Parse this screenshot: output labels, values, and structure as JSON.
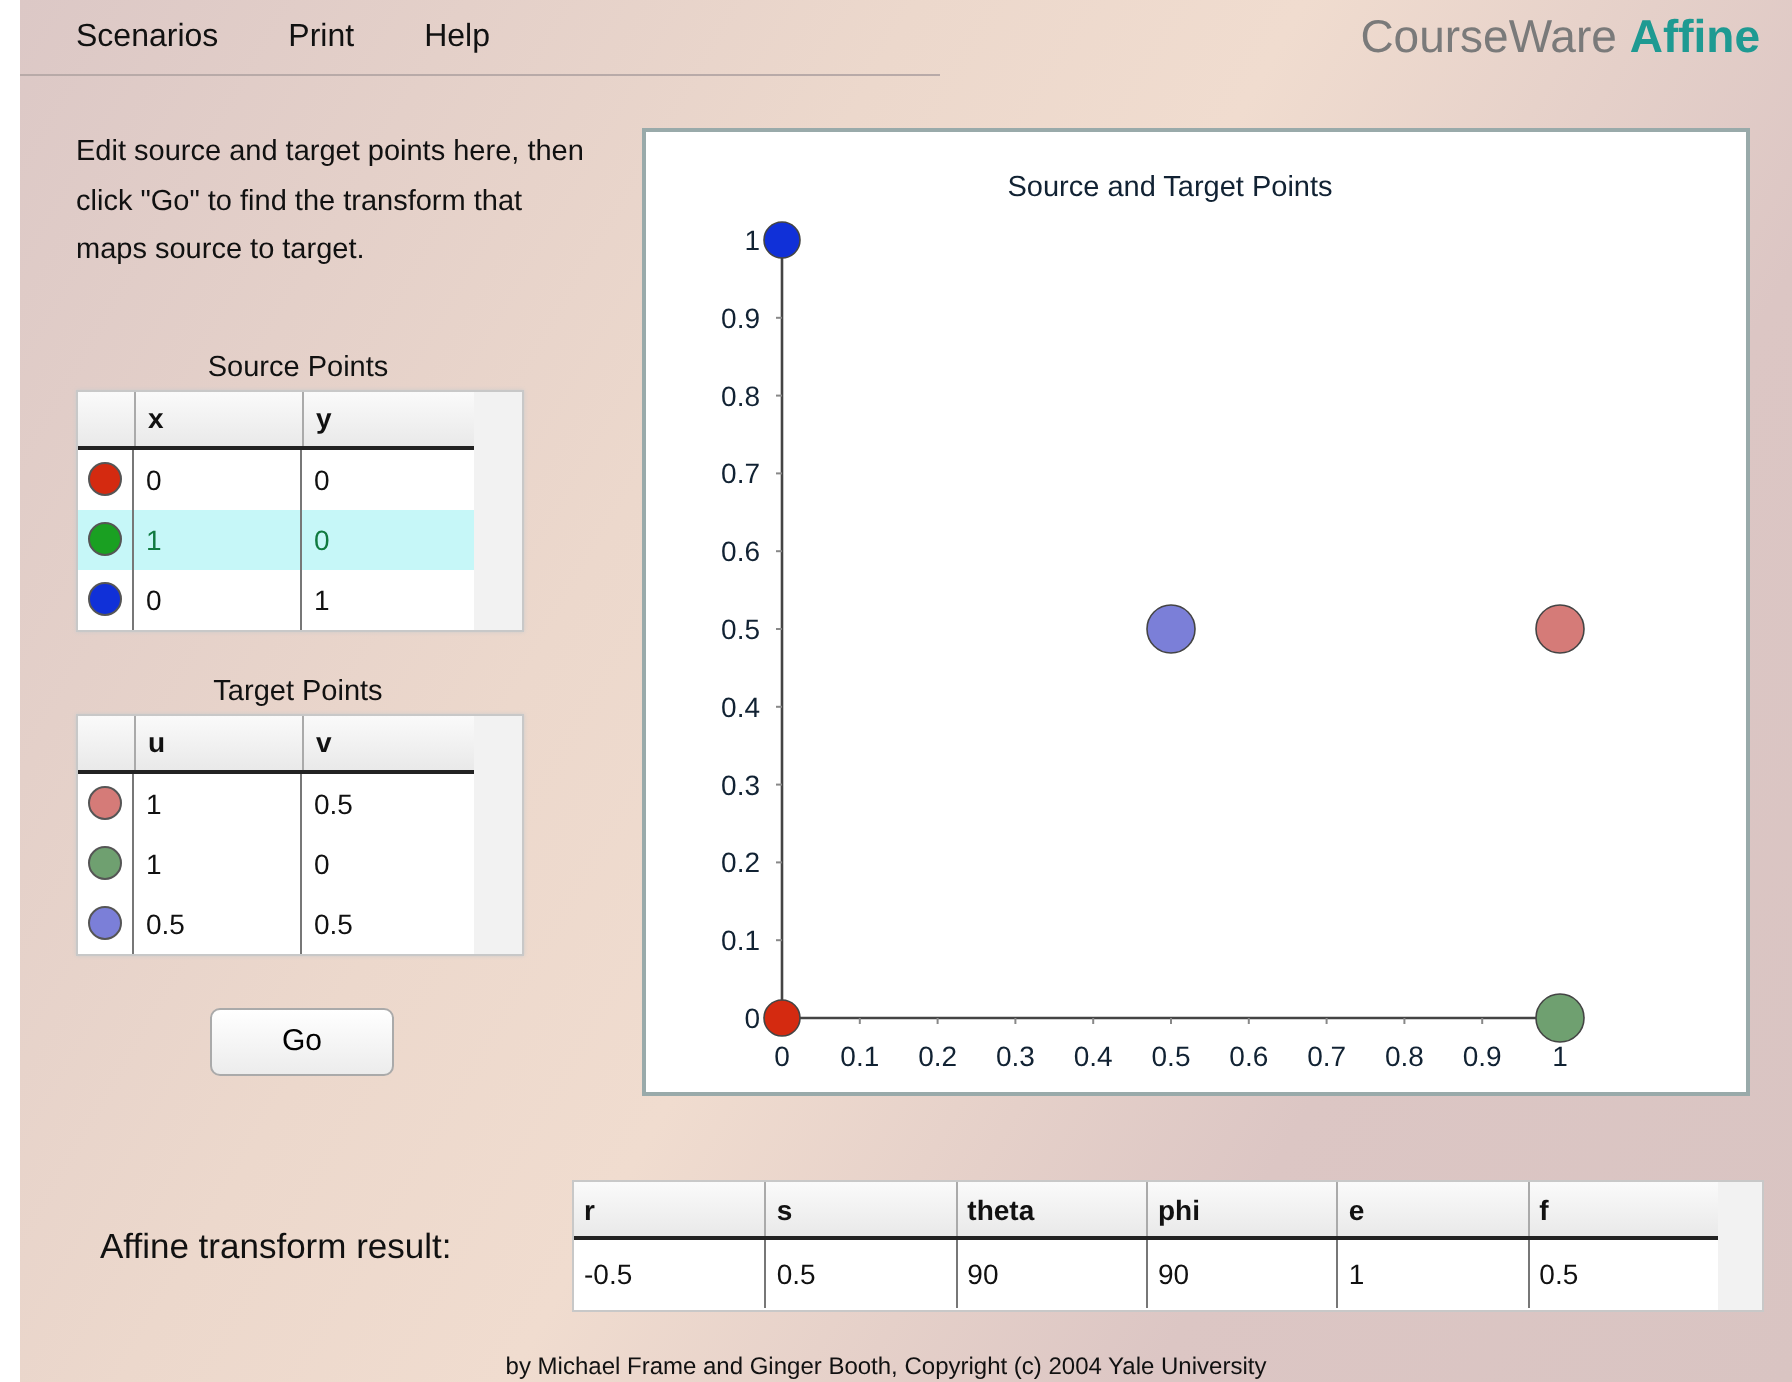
{
  "menu": [
    "Scenarios",
    "Print",
    "Help"
  ],
  "brand": {
    "name": "CourseWare",
    "product": "Affine"
  },
  "instructions": "Edit source and target points here, then click \"Go\" to find the transform that maps source to target.",
  "source_table": {
    "title": "Source Points",
    "columns": [
      "x",
      "y"
    ],
    "rows": [
      {
        "color": "#d42a10",
        "cells": [
          "0",
          "0"
        ],
        "selected": false
      },
      {
        "color": "#1aa022",
        "cells": [
          "1",
          "0"
        ],
        "selected": true
      },
      {
        "color": "#1030d8",
        "cells": [
          "0",
          "1"
        ],
        "selected": false
      }
    ]
  },
  "target_table": {
    "title": "Target Points",
    "columns": [
      "u",
      "v"
    ],
    "rows": [
      {
        "color": "#d57b78",
        "cells": [
          "1",
          "0.5"
        ],
        "selected": false
      },
      {
        "color": "#6fa070",
        "cells": [
          "1",
          "0"
        ],
        "selected": false
      },
      {
        "color": "#7b7fd8",
        "cells": [
          "0.5",
          "0.5"
        ],
        "selected": false
      }
    ]
  },
  "go_button": "Go",
  "chart": {
    "chart_data": {
      "type": "scatter",
      "title": "Source and Target Points",
      "xlim": [
        0,
        1
      ],
      "ylim": [
        0,
        1
      ],
      "xticks": [
        0,
        0.1,
        0.2,
        0.3,
        0.4,
        0.5,
        0.6,
        0.7,
        0.8,
        0.9,
        1
      ],
      "yticks": [
        0,
        0.1,
        0.2,
        0.3,
        0.4,
        0.5,
        0.6,
        0.7,
        0.8,
        0.9,
        1
      ],
      "series": [
        {
          "color": "#d42a10",
          "x": [
            0
          ],
          "values": [
            0
          ]
        },
        {
          "color": "#1030d8",
          "x": [
            0
          ],
          "values": [
            1
          ]
        },
        {
          "color": "#d57b78",
          "x": [
            1
          ],
          "values": [
            0.5
          ]
        },
        {
          "color": "#6fa070",
          "x": [
            1
          ],
          "values": [
            0
          ]
        },
        {
          "color": "#7b7fd8",
          "x": [
            0.5
          ],
          "values": [
            0.5
          ]
        }
      ]
    }
  },
  "result": {
    "label": "Affine transform result:",
    "columns": [
      "r",
      "s",
      "theta",
      "phi",
      "e",
      "f"
    ],
    "values": [
      "-0.5",
      "0.5",
      "90",
      "90",
      "1",
      "0.5"
    ]
  },
  "footer": "by Michael Frame and Ginger Booth, Copyright (c) 2004 Yale University"
}
